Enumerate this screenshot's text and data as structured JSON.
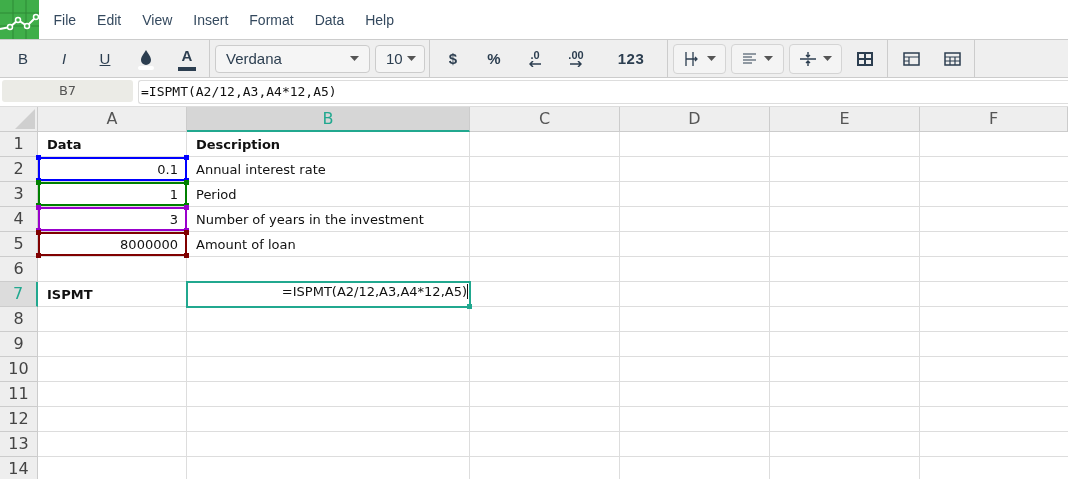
{
  "menu": [
    "File",
    "Edit",
    "View",
    "Insert",
    "Format",
    "Data",
    "Help"
  ],
  "toolbar": {
    "bold": "B",
    "italic": "I",
    "underline": "U",
    "font_color": "A",
    "font": "Verdana",
    "size": "10",
    "currency": "$",
    "percent": "%",
    "decrease_decimals": ".0",
    "increase_decimals": ".00",
    "number_format": "123"
  },
  "formula_bar": {
    "cell_ref": "B7",
    "formula": "=ISPMT(A2/12,A3,A4*12,A5)"
  },
  "columns": [
    {
      "label": "A",
      "selected": false
    },
    {
      "label": "B",
      "selected": true
    },
    {
      "label": "C",
      "selected": false
    },
    {
      "label": "D",
      "selected": false
    },
    {
      "label": "E",
      "selected": false
    },
    {
      "label": "F",
      "selected": false
    }
  ],
  "rows": [
    {
      "label": "1",
      "selected": false,
      "cells": [
        {
          "text": "Data",
          "kind": "text",
          "bold": true
        },
        {
          "text": "Description",
          "kind": "text",
          "bold": true
        }
      ]
    },
    {
      "label": "2",
      "selected": false,
      "cells": [
        {
          "text": "0.1",
          "kind": "number",
          "bold": false,
          "color": "#0000ff"
        },
        {
          "text": "Annual interest rate",
          "kind": "text",
          "bold": false
        }
      ]
    },
    {
      "label": "3",
      "selected": false,
      "cells": [
        {
          "text": "1",
          "kind": "number",
          "bold": false,
          "color": "#008000"
        },
        {
          "text": "Period",
          "kind": "text",
          "bold": false
        }
      ]
    },
    {
      "label": "4",
      "selected": false,
      "cells": [
        {
          "text": "3",
          "kind": "number",
          "bold": false,
          "color": "#9900cc"
        },
        {
          "text": "Number of years in the investment",
          "kind": "text",
          "bold": false
        }
      ]
    },
    {
      "label": "5",
      "selected": false,
      "cells": [
        {
          "text": "8000000",
          "kind": "number",
          "bold": false,
          "color": "#800000"
        },
        {
          "text": "Amount of loan",
          "kind": "text",
          "bold": false
        }
      ]
    },
    {
      "label": "6",
      "selected": false,
      "cells": []
    },
    {
      "label": "7",
      "selected": true,
      "cells": [
        {
          "text": "ISPMT",
          "kind": "text",
          "bold": true
        },
        {
          "text": "=ISPMT(A2/12,A3,A4*12,A5)",
          "kind": "editing",
          "bold": false
        }
      ]
    },
    {
      "label": "8",
      "selected": false,
      "cells": []
    },
    {
      "label": "9",
      "selected": false,
      "cells": []
    },
    {
      "label": "10",
      "selected": false,
      "cells": []
    },
    {
      "label": "11",
      "selected": false,
      "cells": []
    },
    {
      "label": "12",
      "selected": false,
      "cells": []
    },
    {
      "label": "13",
      "selected": false,
      "cells": []
    },
    {
      "label": "14",
      "selected": false,
      "cells": []
    }
  ]
}
